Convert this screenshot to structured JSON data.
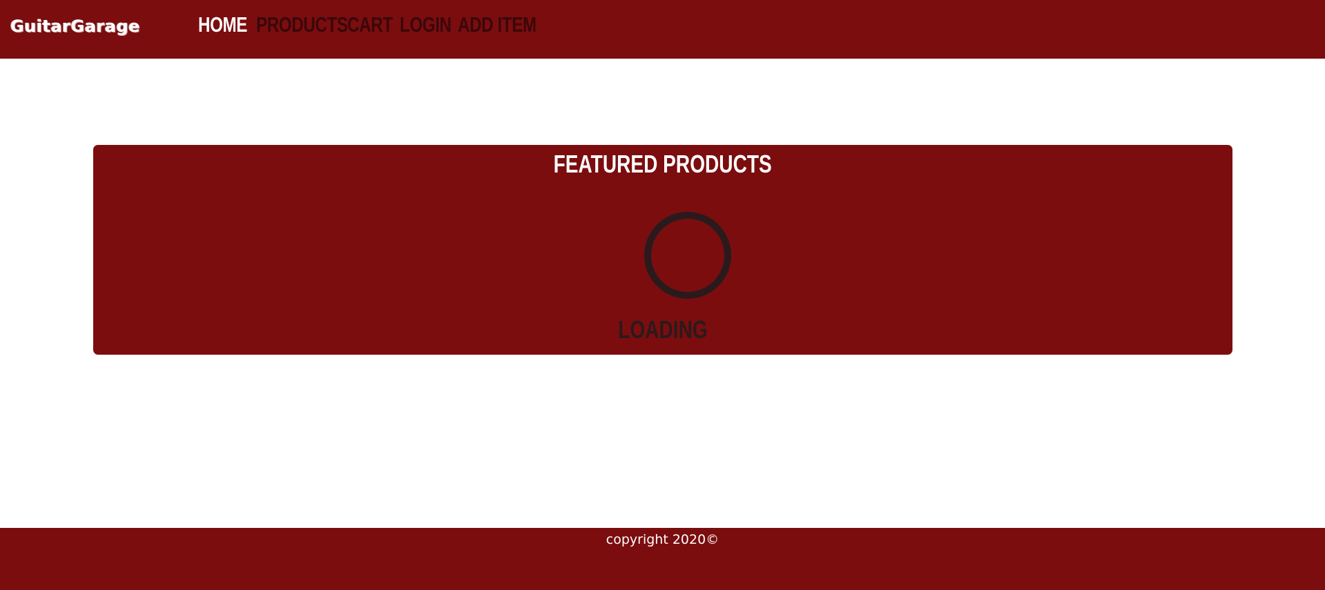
{
  "header": {
    "logo_text": "GuitarGarage",
    "nav": [
      {
        "label": "HOME",
        "active": true
      },
      {
        "label": "PRODUCTS",
        "active": false
      },
      {
        "label": "CART",
        "active": false
      },
      {
        "label": "LOGIN",
        "active": false
      },
      {
        "label": "ADD ITEM",
        "active": false
      }
    ]
  },
  "featured": {
    "title": "FEATURED PRODUCTS",
    "loading_text": "LOADING"
  },
  "footer": {
    "copyright": "copyright 2020©"
  },
  "colors": {
    "brand": "#7b0d0f",
    "nav_inactive": "#3a0709",
    "nav_active": "#ffffff",
    "spinner": "#2b1a1b"
  }
}
